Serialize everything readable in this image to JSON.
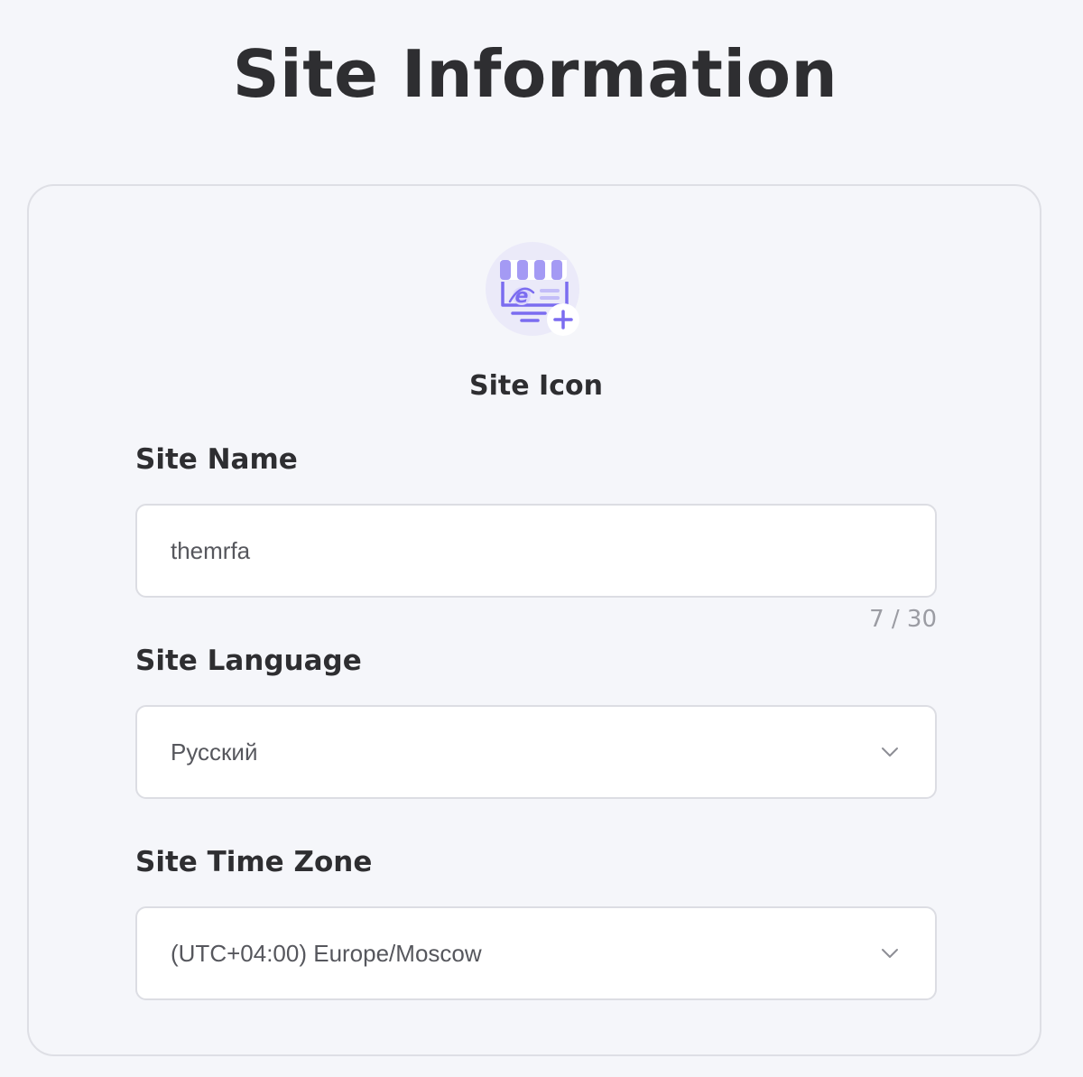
{
  "page": {
    "title": "Site Information"
  },
  "site_icon": {
    "caption": "Site Icon",
    "icon": "storefront-add-icon",
    "accent_color": "#7b6cf0"
  },
  "site_name": {
    "label": "Site Name",
    "value": "themrfa",
    "counter": "7 / 30"
  },
  "site_language": {
    "label": "Site Language",
    "selected": "Русский",
    "icon": "chevron-down-icon"
  },
  "site_time_zone": {
    "label": "Site Time Zone",
    "selected": "(UTC+04:00) Europe/Moscow",
    "icon": "chevron-down-icon"
  }
}
